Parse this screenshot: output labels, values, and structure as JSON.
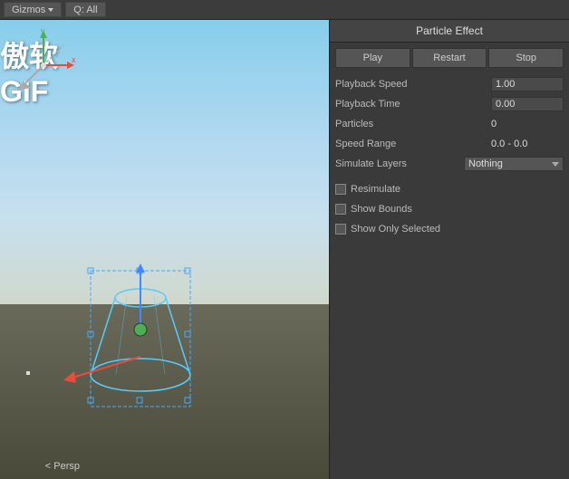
{
  "toolbar": {
    "gizmos_label": "Gizmos",
    "all_label": "Q: All"
  },
  "viewport": {
    "persp_label": "< Persp",
    "overlay_text": "傲软GIF"
  },
  "panel": {
    "title": "Particle Effect",
    "play_label": "Play",
    "restart_label": "Restart",
    "stop_label": "Stop",
    "props": [
      {
        "label": "Playback Speed",
        "value": "1.00"
      },
      {
        "label": "Playback Time",
        "value": "0.00"
      },
      {
        "label": "Particles",
        "value": "0"
      },
      {
        "label": "Speed Range",
        "value": "0.0 - 0.0"
      },
      {
        "label": "Simulate Layers",
        "value": "Nothing"
      }
    ],
    "checkboxes": [
      {
        "label": "Resimulate",
        "checked": false
      },
      {
        "label": "Show Bounds",
        "checked": false
      },
      {
        "label": "Show Only Selected",
        "checked": false
      }
    ]
  }
}
